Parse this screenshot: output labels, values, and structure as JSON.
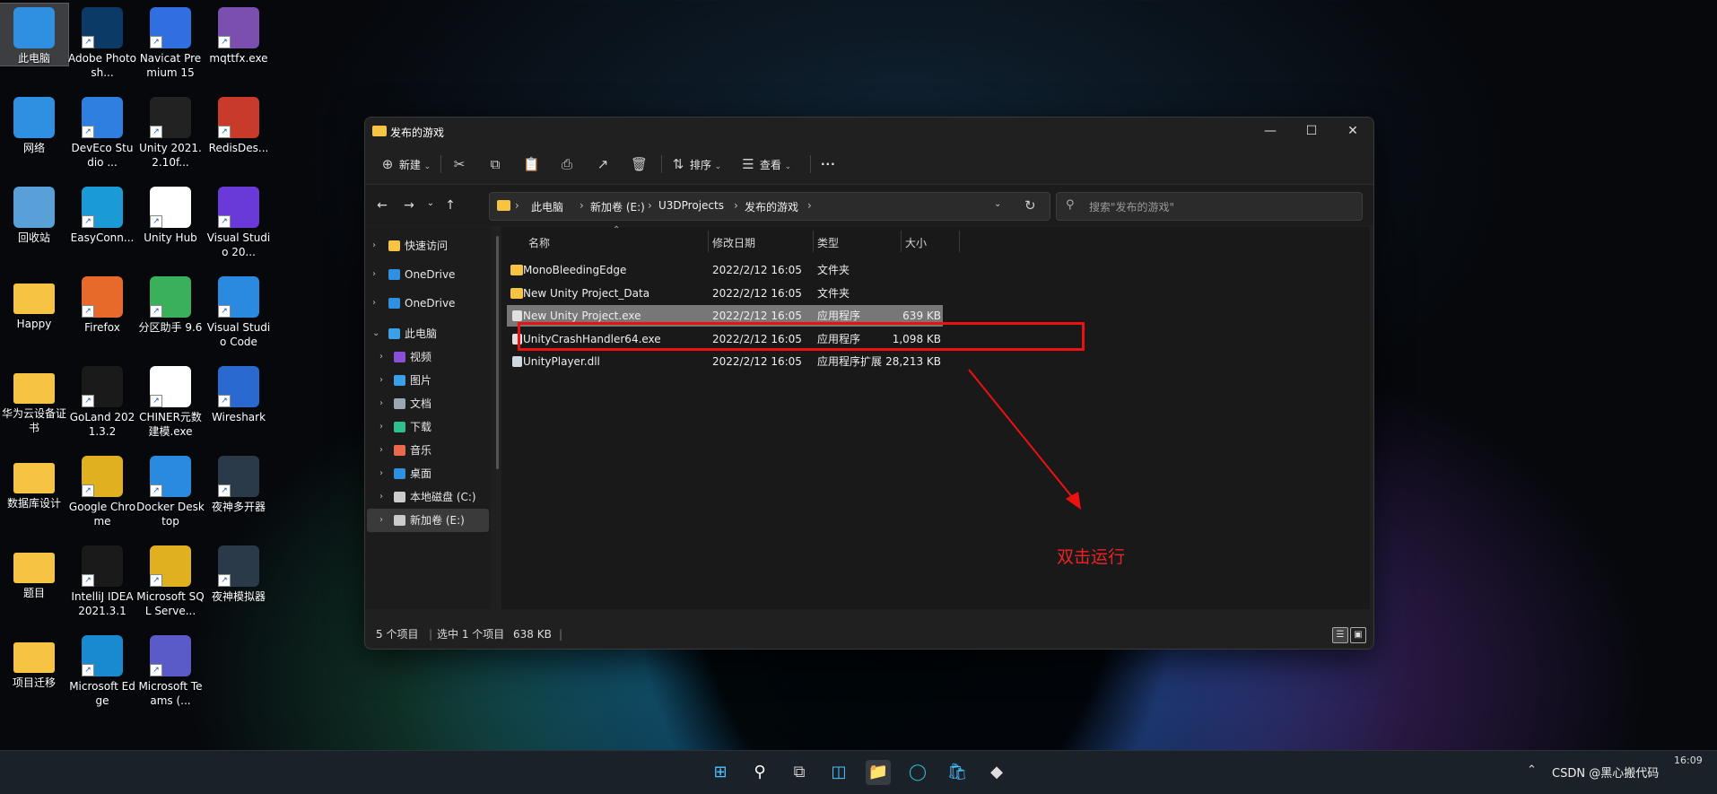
{
  "desktop": {
    "icons": [
      {
        "label": "此电脑",
        "icon": "computer-icon"
      },
      {
        "label": "Adobe Photosh...",
        "icon": "photoshop-icon"
      },
      {
        "label": "Navicat Premium 15",
        "icon": "navicat-icon"
      },
      {
        "label": "mqttfx.exe",
        "icon": "mqttfx-icon"
      },
      {
        "label": "网络",
        "icon": "network-icon"
      },
      {
        "label": "DevEco Studio ...",
        "icon": "deveco-icon"
      },
      {
        "label": "Unity 2021.2.10f...",
        "icon": "unity-icon"
      },
      {
        "label": "RedisDes...",
        "icon": "redis-icon"
      },
      {
        "label": "回收站",
        "icon": "recycle-bin-icon"
      },
      {
        "label": "EasyConn...",
        "icon": "easyconnect-icon"
      },
      {
        "label": "Unity Hub",
        "icon": "unity-hub-icon"
      },
      {
        "label": "Visual Studio 20...",
        "icon": "visual-studio-icon"
      },
      {
        "label": "Happy",
        "icon": "folder-icon"
      },
      {
        "label": "Firefox",
        "icon": "firefox-icon"
      },
      {
        "label": "分区助手 9.6",
        "icon": "partition-icon"
      },
      {
        "label": "Visual Studio Code",
        "icon": "vscode-icon"
      },
      {
        "label": "华为云设备证书",
        "icon": "folder-icon"
      },
      {
        "label": "GoLand 2021.3.2",
        "icon": "goland-icon"
      },
      {
        "label": "CHINER元数建模.exe",
        "icon": "chiner-icon"
      },
      {
        "label": "Wireshark",
        "icon": "wireshark-icon"
      },
      {
        "label": "数据库设计",
        "icon": "folder-icon"
      },
      {
        "label": "Google Chrome",
        "icon": "chrome-icon"
      },
      {
        "label": "Docker Desktop",
        "icon": "docker-icon"
      },
      {
        "label": "夜神多开器",
        "icon": "nox-icon"
      },
      {
        "label": "题目",
        "icon": "folder-icon"
      },
      {
        "label": "IntelliJ IDEA 2021.3.1",
        "icon": "intellij-icon"
      },
      {
        "label": "Microsoft SQL Serve...",
        "icon": "sqlserver-icon"
      },
      {
        "label": "夜神模拟器",
        "icon": "nox-icon"
      },
      {
        "label": "项目迁移",
        "icon": "folder-icon"
      },
      {
        "label": "Microsoft Edge",
        "icon": "edge-icon"
      },
      {
        "label": "Microsoft Teams (...",
        "icon": "teams-icon"
      }
    ]
  },
  "window": {
    "title": "发布的游戏",
    "toolbar": {
      "new_label": "新建",
      "sort_label": "排序",
      "view_label": "查看",
      "more_label": "···"
    },
    "address": {
      "crumbs": [
        "此电脑",
        "新加卷 (E:)",
        "U3DProjects",
        "发布的游戏"
      ]
    },
    "search": {
      "placeholder": "搜索\"发布的游戏\""
    },
    "sidebar": {
      "items": [
        {
          "label": "快速访问",
          "icon": "star-icon",
          "color": "#f6c342"
        },
        {
          "label": "OneDrive",
          "icon": "cloud-icon",
          "color": "#2f8fe0"
        },
        {
          "label": "OneDrive",
          "icon": "cloud-icon",
          "color": "#2f8fe0"
        },
        {
          "label": "此电脑",
          "icon": "computer-icon",
          "color": "#3aa0e8"
        },
        {
          "label": "视频",
          "icon": "video-icon",
          "color": "#8a4fd8"
        },
        {
          "label": "图片",
          "icon": "pictures-icon",
          "color": "#3aa0e8"
        },
        {
          "label": "文档",
          "icon": "documents-icon",
          "color": "#9aa7b4"
        },
        {
          "label": "下载",
          "icon": "download-icon",
          "color": "#2fbf8f"
        },
        {
          "label": "音乐",
          "icon": "music-icon",
          "color": "#e86a4a"
        },
        {
          "label": "桌面",
          "icon": "desktop-icon",
          "color": "#2f8fe0"
        },
        {
          "label": "本地磁盘 (C:)",
          "icon": "drive-icon",
          "color": "#cccccc"
        },
        {
          "label": "新加卷 (E:)",
          "icon": "drive-icon",
          "color": "#cccccc"
        }
      ]
    },
    "columns": {
      "name": "名称",
      "date": "修改日期",
      "type": "类型",
      "size": "大小"
    },
    "files": [
      {
        "name": "MonoBleedingEdge",
        "date": "2022/2/12 16:05",
        "type": "文件夹",
        "size": "",
        "icon": "folder-icon"
      },
      {
        "name": "New Unity Project_Data",
        "date": "2022/2/12 16:05",
        "type": "文件夹",
        "size": "",
        "icon": "folder-icon"
      },
      {
        "name": "New Unity Project.exe",
        "date": "2022/2/12 16:05",
        "type": "应用程序",
        "size": "639 KB",
        "icon": "unity-app-icon"
      },
      {
        "name": "UnityCrashHandler64.exe",
        "date": "2022/2/12 16:05",
        "type": "应用程序",
        "size": "1,098 KB",
        "icon": "unity-app-icon"
      },
      {
        "name": "UnityPlayer.dll",
        "date": "2022/2/12 16:05",
        "type": "应用程序扩展",
        "size": "28,213 KB",
        "icon": "dll-file-icon"
      }
    ],
    "status": {
      "count": "5 个项目",
      "selected": "选中 1 个项目",
      "selected_size": "638 KB"
    }
  },
  "annotation": {
    "text": "双击运行",
    "color": "#e11111"
  },
  "taskbar": {
    "clock": "16:09",
    "watermark": "CSDN @黑心搬代码"
  }
}
